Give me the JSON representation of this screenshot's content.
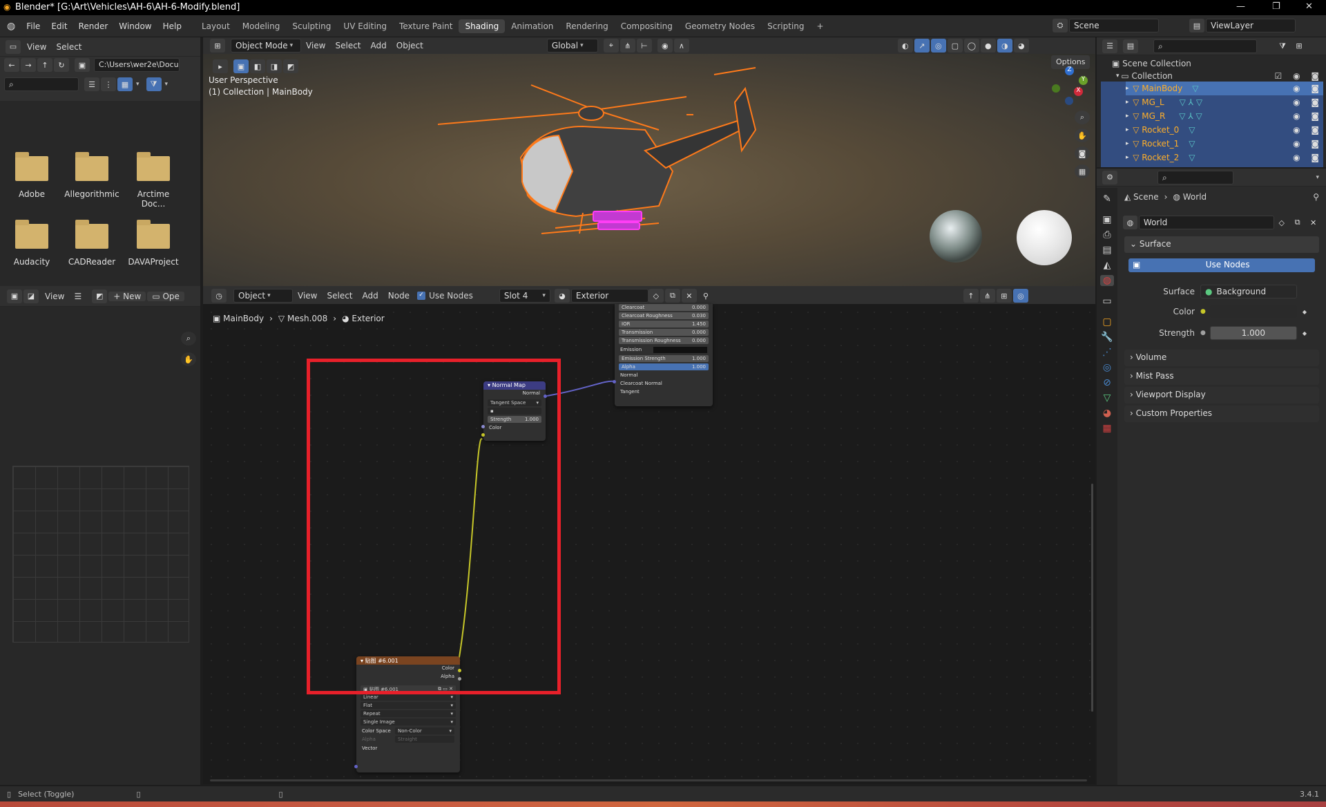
{
  "window": {
    "title": "Blender* [G:\\Art\\Vehicles\\AH-6\\AH-6-Modify.blend]",
    "minimize": "—",
    "maximize": "❐",
    "close": "✕"
  },
  "menu": [
    "File",
    "Edit",
    "Render",
    "Window",
    "Help"
  ],
  "workspaces": [
    "Layout",
    "Modeling",
    "Sculpting",
    "UV Editing",
    "Texture Paint",
    "Shading",
    "Animation",
    "Rendering",
    "Compositing",
    "Geometry Nodes",
    "Scripting"
  ],
  "active_workspace": "Shading",
  "add_workspace": "+",
  "scene": {
    "name": "Scene",
    "view_layer": "ViewLayer"
  },
  "file_browser": {
    "menu": [
      "View",
      "Select"
    ],
    "path": "C:\\Users\\wer2e\\Docu...",
    "folders": [
      "Adobe",
      "Allegorithmic",
      "Arctime Doc...",
      "Audacity",
      "CADReader",
      "DAVAProject",
      "",
      "",
      ""
    ]
  },
  "viewport": {
    "mode": "Object Mode",
    "menu": [
      "View",
      "Select",
      "Add",
      "Object"
    ],
    "orientation": "Global",
    "options": "Options",
    "info_line1": "User Perspective",
    "info_line2": "(1) Collection | MainBody",
    "gizmo": {
      "z": "Z",
      "y": "Y",
      "x": "X"
    }
  },
  "image_editor": {
    "view": "View",
    "new": "New",
    "open": "Ope"
  },
  "node_editor": {
    "type": "Object",
    "menu": [
      "View",
      "Select",
      "Add",
      "Node"
    ],
    "use_nodes": "Use Nodes",
    "slot": "Slot 4",
    "material": "Exterior",
    "breadcrumb": [
      "MainBody",
      "Mesh.008",
      "Exterior"
    ]
  },
  "bsdf_node": {
    "rows": [
      {
        "label": "Clearcoat",
        "value": "0.000"
      },
      {
        "label": "Clearcoat Roughness",
        "value": "0.030"
      },
      {
        "label": "IOR",
        "value": "1.450"
      },
      {
        "label": "Transmission",
        "value": "0.000"
      },
      {
        "label": "Transmission Roughness",
        "value": "0.000"
      },
      {
        "label": "Emission",
        "value": ""
      },
      {
        "label": "Emission Strength",
        "value": "1.000"
      },
      {
        "label": "Alpha",
        "value": "1.000"
      }
    ],
    "inputs": [
      "Normal",
      "Clearcoat Normal",
      "Tangent"
    ]
  },
  "normal_map_node": {
    "title": "Normal Map",
    "output": "Normal",
    "space": "Tangent Space",
    "strength_label": "Strength",
    "strength": "1.000",
    "color_input": "Color"
  },
  "image_node": {
    "title": "贴图 #6.001",
    "outputs": [
      "Color",
      "Alpha"
    ],
    "image_name": "贴图 #6.001",
    "interpolation": "Linear",
    "projection": "Flat",
    "extension": "Repeat",
    "source": "Single Image",
    "color_space_label": "Color Space",
    "color_space": "Non-Color",
    "alpha_label": "Alpha",
    "alpha_mode": "Straight",
    "vector": "Vector"
  },
  "outliner": {
    "root": "Scene Collection",
    "collection": "Collection",
    "items": [
      "MainBody",
      "MG_L",
      "MG_R",
      "Rocket_0",
      "Rocket_1",
      "Rocket_2"
    ]
  },
  "properties": {
    "breadcrumb": [
      "Scene",
      "World"
    ],
    "world_name": "World",
    "surface_panel": "Surface",
    "use_nodes": "Use Nodes",
    "surface_label": "Surface",
    "surface_value": "Background",
    "color_label": "Color",
    "strength_label": "Strength",
    "strength_value": "1.000",
    "panels": [
      "Volume",
      "Mist Pass",
      "Viewport Display",
      "Custom Properties"
    ]
  },
  "status": {
    "hint": "Select (Toggle)",
    "version": "3.4.1"
  },
  "colors": {
    "accent": "#4772b3",
    "selection_outline": "#ff7a1a",
    "highlight_box": "#e8202a",
    "node_normal_header": "#3c3c83",
    "node_image_header": "#7a4420"
  }
}
